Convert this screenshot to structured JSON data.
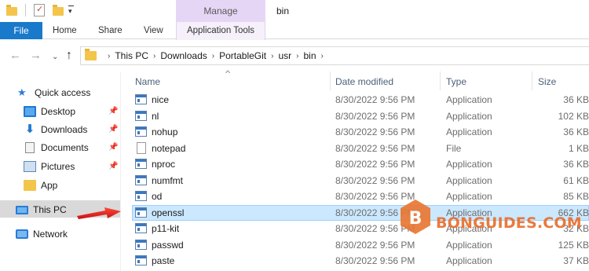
{
  "titlebar": {
    "manage_label": "Manage",
    "window_title": "bin"
  },
  "ribbon": {
    "file": "File",
    "home": "Home",
    "share": "Share",
    "view": "View",
    "application_tools": "Application Tools"
  },
  "address": {
    "crumbs": [
      "This PC",
      "Downloads",
      "PortableGit",
      "usr",
      "bin"
    ]
  },
  "sidebar": {
    "quick_access": "Quick access",
    "items": [
      "Desktop",
      "Downloads",
      "Documents",
      "Pictures",
      "App"
    ],
    "this_pc": "This PC",
    "network": "Network"
  },
  "columns": {
    "name": "Name",
    "date": "Date modified",
    "type": "Type",
    "size": "Size"
  },
  "files": [
    {
      "name": "nice",
      "date": "8/30/2022 9:56 PM",
      "type": "Application",
      "size": "36 KB",
      "icon": "app-icon"
    },
    {
      "name": "nl",
      "date": "8/30/2022 9:56 PM",
      "type": "Application",
      "size": "102 KB",
      "icon": "app-icon"
    },
    {
      "name": "nohup",
      "date": "8/30/2022 9:56 PM",
      "type": "Application",
      "size": "36 KB",
      "icon": "app-icon"
    },
    {
      "name": "notepad",
      "date": "8/30/2022 9:56 PM",
      "type": "File",
      "size": "1 KB",
      "icon": "file-icon"
    },
    {
      "name": "nproc",
      "date": "8/30/2022 9:56 PM",
      "type": "Application",
      "size": "36 KB",
      "icon": "app-icon"
    },
    {
      "name": "numfmt",
      "date": "8/30/2022 9:56 PM",
      "type": "Application",
      "size": "61 KB",
      "icon": "app-icon"
    },
    {
      "name": "od",
      "date": "8/30/2022 9:56 PM",
      "type": "Application",
      "size": "85 KB",
      "icon": "app-icon"
    },
    {
      "name": "openssl",
      "date": "8/30/2022 9:56 PM",
      "type": "Application",
      "size": "662 KB",
      "icon": "app-icon"
    },
    {
      "name": "p11-kit",
      "date": "8/30/2022 9:56 PM",
      "type": "Application",
      "size": "32 KB",
      "icon": "app-icon"
    },
    {
      "name": "passwd",
      "date": "8/30/2022 9:56 PM",
      "type": "Application",
      "size": "125 KB",
      "icon": "app-icon"
    },
    {
      "name": "paste",
      "date": "8/30/2022 9:56 PM",
      "type": "Application",
      "size": "37 KB",
      "icon": "app-icon"
    }
  ],
  "selected_file": "openssl",
  "watermark": {
    "text": "BONGUIDES.COM",
    "logo_letter": "B"
  },
  "colors": {
    "file_tab": "#1979ca",
    "manage_tab": "#e6d6f5",
    "selection": "#cce8ff",
    "arrow": "#e02020",
    "watermark": "#e86b28"
  }
}
